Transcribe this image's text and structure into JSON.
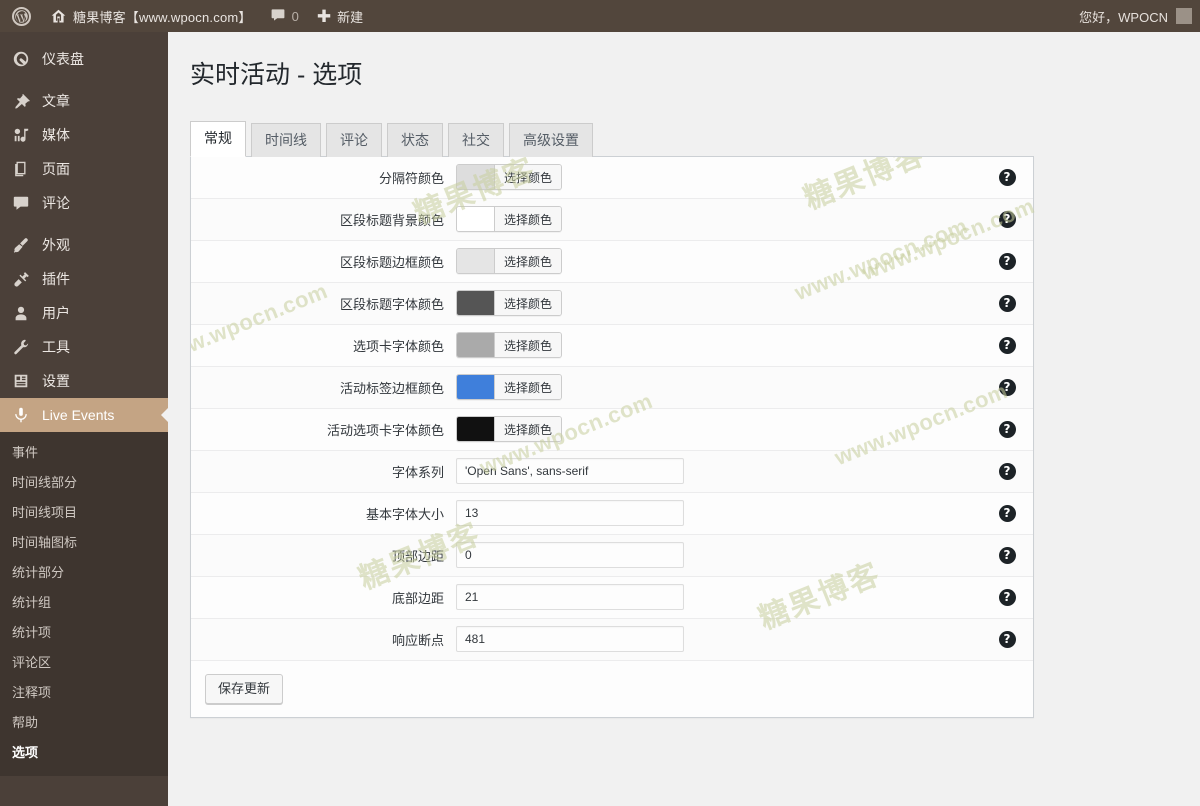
{
  "adminbar": {
    "wp_logo": "W",
    "site_name": "糖果博客【www.wpocn.com】",
    "comment_count": "0",
    "new_label": "新建",
    "greeting": "您好，WPOCN"
  },
  "sidebar": {
    "items": [
      {
        "label": "仪表盘",
        "icon": "dashboard-icon"
      },
      {
        "label": "文章",
        "icon": "pin-icon"
      },
      {
        "label": "媒体",
        "icon": "media-icon"
      },
      {
        "label": "页面",
        "icon": "page-icon"
      },
      {
        "label": "评论",
        "icon": "comment-icon"
      },
      {
        "label": "外观",
        "icon": "appearance-icon"
      },
      {
        "label": "插件",
        "icon": "plugin-icon"
      },
      {
        "label": "用户",
        "icon": "user-icon"
      },
      {
        "label": "工具",
        "icon": "tools-icon"
      },
      {
        "label": "设置",
        "icon": "settings-icon"
      },
      {
        "label": "Live Events",
        "icon": "microphone-icon"
      }
    ],
    "submenu": [
      "事件",
      "时间线部分",
      "时间线项目",
      "时间轴图标",
      "统计部分",
      "统计组",
      "统计项",
      "评论区",
      "注释项",
      "帮助",
      "选项"
    ],
    "active_submenu": "选项"
  },
  "page": {
    "title": "实时活动 - 选项"
  },
  "tabs": [
    {
      "label": "常规",
      "active": true
    },
    {
      "label": "时间线",
      "active": false
    },
    {
      "label": "评论",
      "active": false
    },
    {
      "label": "状态",
      "active": false
    },
    {
      "label": "社交",
      "active": false
    },
    {
      "label": "高级设置",
      "active": false
    }
  ],
  "form": {
    "pick_color_label": "选择颜色",
    "help_glyph": "?",
    "color_rows": [
      {
        "label": "分隔符颜色",
        "color": "#dddddd"
      },
      {
        "label": "区段标题背景颜色",
        "color": "#ffffff"
      },
      {
        "label": "区段标题边框颜色",
        "color": "#e5e5e5"
      },
      {
        "label": "区段标题字体颜色",
        "color": "#555555"
      },
      {
        "label": "选项卡字体颜色",
        "color": "#aaaaaa"
      },
      {
        "label": "活动标签边框颜色",
        "color": "#3f7fdb"
      },
      {
        "label": "活动选项卡字体颜色",
        "color": "#111111"
      }
    ],
    "text_rows": [
      {
        "label": "字体系列",
        "value": "'Open Sans', sans-serif"
      },
      {
        "label": "基本字体大小",
        "value": "13"
      },
      {
        "label": "顶部边距",
        "value": "0"
      },
      {
        "label": "底部边距",
        "value": "21"
      },
      {
        "label": "响应断点",
        "value": "481"
      }
    ],
    "save_label": "保存更新"
  },
  "watermarks": {
    "cn": "糖果博客",
    "en": "www.wpocn.com"
  },
  "colors": {
    "adminbar_bg": "#52463c",
    "sidebar_bg": "#4b4039",
    "submenu_bg": "#3e352f",
    "current_menu_bg": "#c4a484",
    "content_bg": "#f1f1f1",
    "watermark": "#c8cf9e"
  }
}
